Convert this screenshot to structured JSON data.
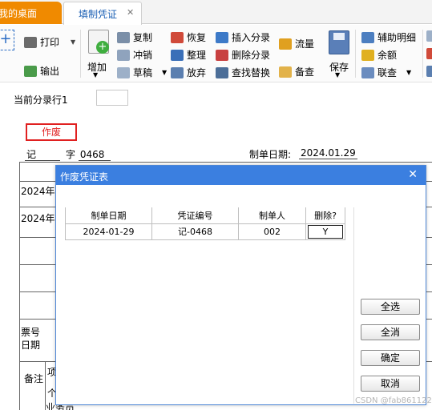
{
  "tabs": {
    "home": "我的桌面",
    "active": "填制凭证",
    "close_glyph": "✕"
  },
  "toolbar": {
    "add_left": "+",
    "print": "打印",
    "export": "输出",
    "add": "增加",
    "copy": "复制",
    "reverse": "冲销",
    "draft": "草稿",
    "restore": "恢复",
    "organize": "整理",
    "discard": "放弃",
    "insert_entry": "插入分录",
    "delete_entry": "删除分录",
    "find_replace": "查找替换",
    "flow": "流量",
    "note": "备查",
    "save": "保存",
    "aux_detail": "辅助明细",
    "balance": "余额",
    "link_query": "联查"
  },
  "entry_row": {
    "label": "当前分录行1",
    "value": ""
  },
  "voucher": {
    "void_stamp": "作废",
    "type": "记",
    "zi": "字",
    "number": "0468",
    "date_label": "制单日期:",
    "date": "2024.01.29",
    "row1": "2024年",
    "row2": "2024年",
    "ticket_no": "票号",
    "ticket_date": "日期",
    "remark": "备注",
    "item": "项",
    "person": "个",
    "business": "业务员"
  },
  "dialog": {
    "title": "作废凭证表",
    "columns": [
      "制单日期",
      "凭证编号",
      "制单人",
      "删除?"
    ],
    "rows": [
      [
        "2024-01-29",
        "记-0468",
        "002",
        "Y"
      ]
    ],
    "buttons": {
      "select_all": "全选",
      "deselect_all": "全消",
      "ok": "确定",
      "cancel": "取消"
    }
  },
  "watermark": "CSDN @fab8611225"
}
